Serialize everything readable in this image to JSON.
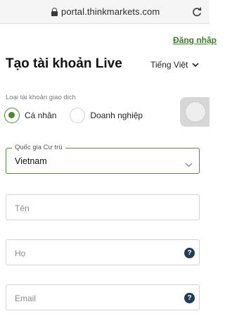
{
  "browser": {
    "url": "portal.thinkmarkets.com"
  },
  "header": {
    "login_link": "Đăng nhập",
    "title": "Tạo tài khoản Live",
    "language": "Tiếng Việt"
  },
  "account_type": {
    "label": "Loại tài khoản giao dịch",
    "options": [
      {
        "label": "Cá nhân",
        "selected": true
      },
      {
        "label": "Doanh nghiệp",
        "selected": false
      }
    ]
  },
  "residence": {
    "label": "Quốc gia Cư trú",
    "value": "Vietnam"
  },
  "fields": {
    "first_name": {
      "placeholder": "Tên"
    },
    "last_name": {
      "placeholder": "Họ",
      "help_icon": "?"
    },
    "email": {
      "placeholder": "Email",
      "help_icon": "?"
    }
  },
  "colors": {
    "accent_green": "#4a8a2a",
    "help_icon_bg": "#1e3d52"
  }
}
